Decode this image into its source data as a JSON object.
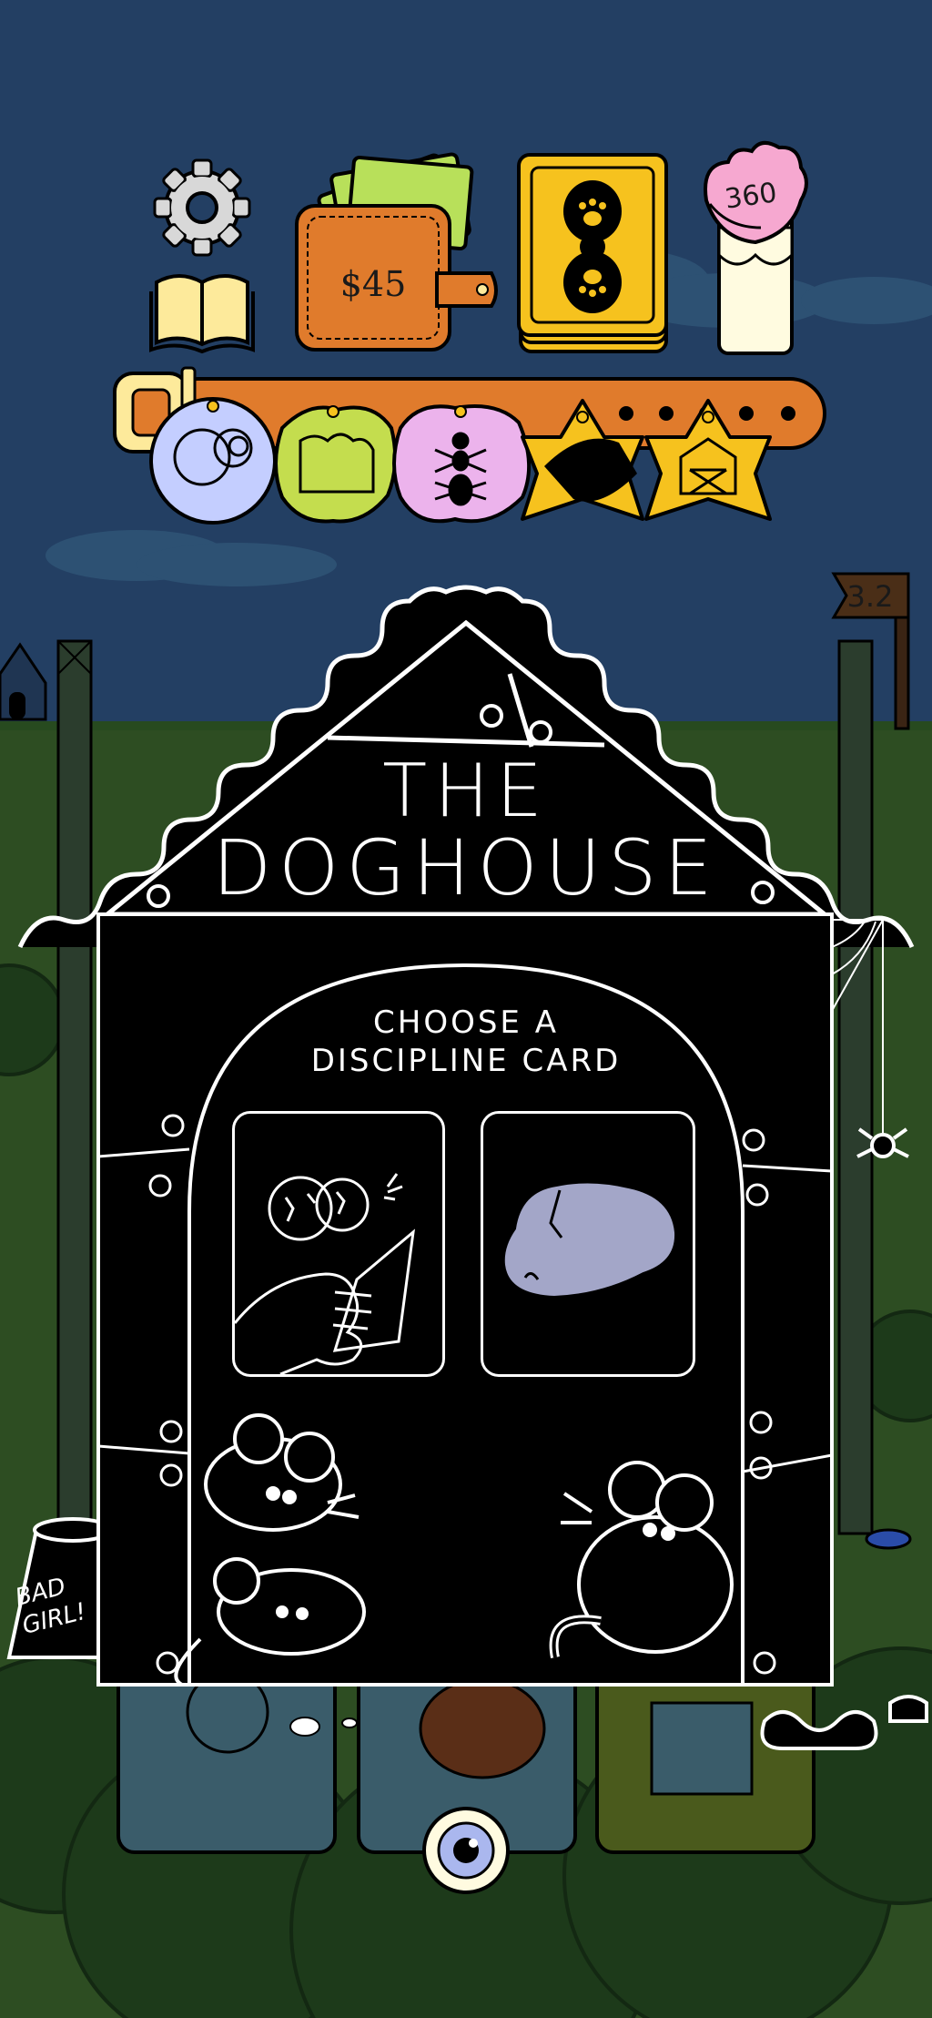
{
  "hud": {
    "settings_icon": "gear-icon",
    "rulebook_icon": "book-icon",
    "wallet": {
      "icon": "wallet-icon",
      "money": "$45"
    },
    "deck_icon": "card-deck-icon",
    "glass": {
      "icon": "milk-glass-icon",
      "value": "360"
    }
  },
  "collar": {
    "tags": [
      {
        "name": "bubbles",
        "color": "#c4ceff"
      },
      {
        "name": "glove",
        "color": "#c4dd4e"
      },
      {
        "name": "ant",
        "color": "#ecb3ec"
      },
      {
        "name": "dog",
        "color": "#f6c21e"
      },
      {
        "name": "barn",
        "color": "#f6c21e"
      }
    ]
  },
  "level_flag": "3.2",
  "doghouse": {
    "title_line1": "THE",
    "title_line2": "DOGHOUSE",
    "prompt_line1": "CHOOSE A",
    "prompt_line2": "DISCIPLINE CARD",
    "cards": [
      {
        "id": "reading-paper",
        "icon": "reading-paper-icon"
      },
      {
        "id": "rock",
        "icon": "rock-icon"
      }
    ]
  },
  "bowl_text": [
    "BAD",
    "GIRL!"
  ],
  "bottom_button_icon": "eye-icon",
  "colors": {
    "sky": "#233f63",
    "grass": "#2d4d22",
    "doghouse": "#000000",
    "wallet": "#e07b2c",
    "deck": "#f6c21e",
    "collar": "#e07b2c"
  }
}
